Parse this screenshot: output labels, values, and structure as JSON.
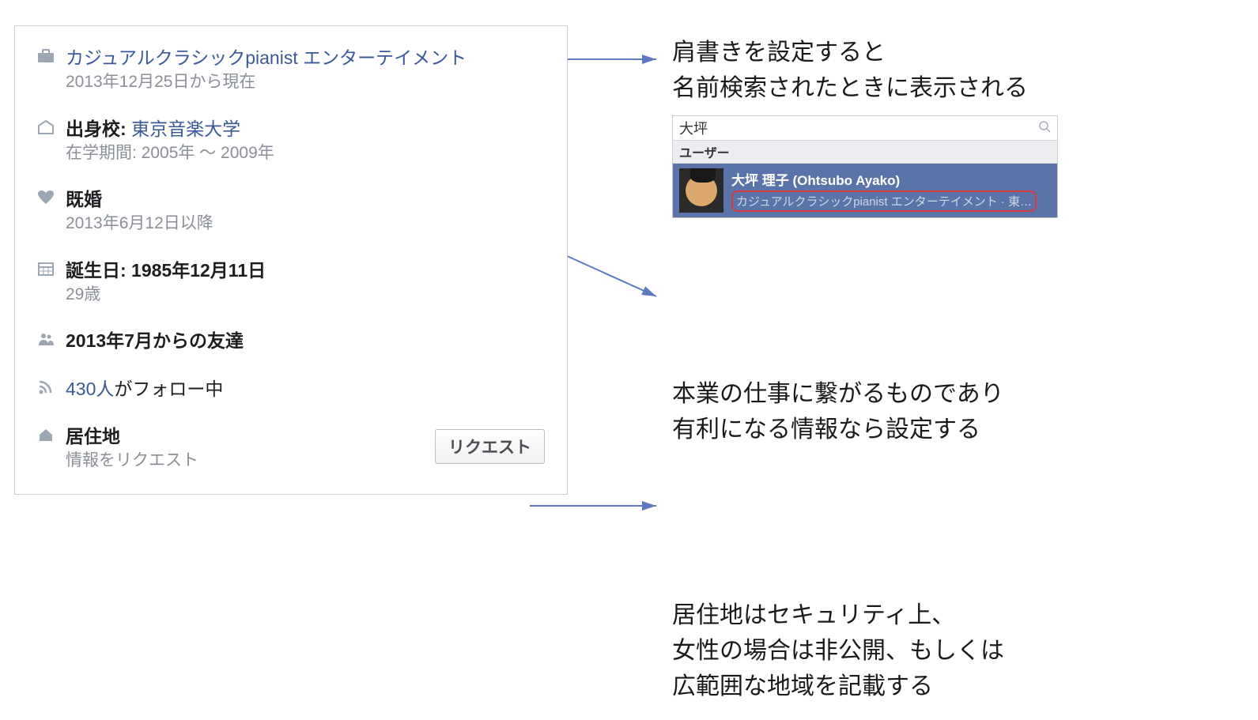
{
  "profile": {
    "work": {
      "title": "カジュアルクラシックpianist エンターテイメント",
      "sub": "2013年12月25日から現在"
    },
    "school": {
      "label": "出身校: ",
      "name": "東京音楽大学",
      "sub": "在学期間: 2005年 ～ 2009年"
    },
    "marital": {
      "status": "既婚",
      "sub": "2013年6月12日以降"
    },
    "birthday": {
      "label": "誕生日: 1985年12月11日",
      "sub": "29歳"
    },
    "friends": "2013年7月からの友達",
    "followers_count": "430人",
    "followers_suffix": "がフォロー中",
    "residence": {
      "label": "居住地",
      "sub": "情報をリクエスト"
    },
    "request_button": "リクエスト"
  },
  "annotations": {
    "ann1": "肩書きを設定すると\n名前検索されたときに表示される",
    "ann2": "本業の仕事に繋がるものであり\n有利になる情報なら設定する",
    "ann3": "居住地はセキュリティ上、\n女性の場合は非公開、もしくは\n広範囲な地域を記載する"
  },
  "search": {
    "query": "大坪",
    "header": "ユーザー",
    "result_name": "大坪 理子 (Ohtsubo Ayako)",
    "result_sub": "カジュアルクラシックpianist エンターテイメント · 東…"
  }
}
